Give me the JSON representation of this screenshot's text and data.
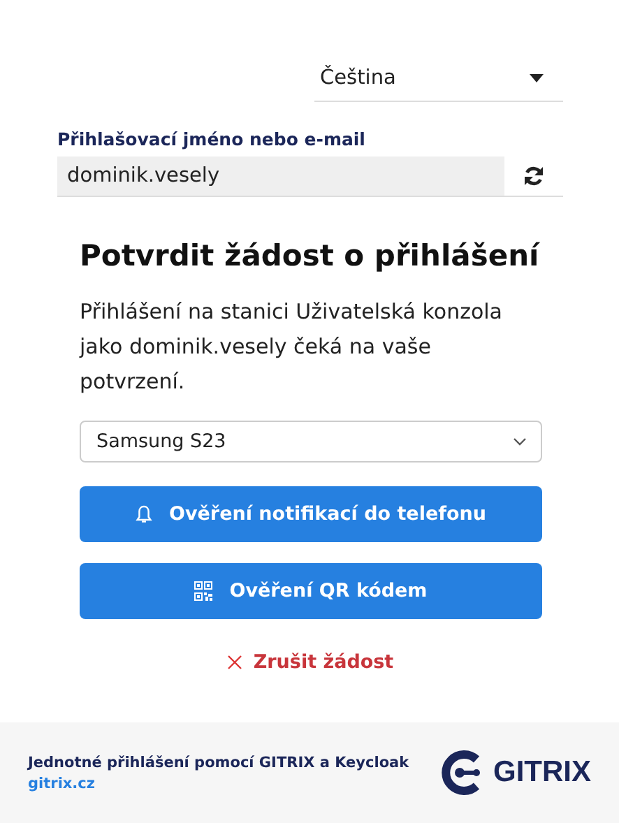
{
  "language": {
    "value": "Čeština"
  },
  "username": {
    "label": "Přihlašovací jméno nebo e-mail",
    "value": "dominik.vesely"
  },
  "heading": "Potvrdit žádost o přihlášení",
  "message": "Přihlášení na stanici Uživatelská konzola jako dominik.vesely čeká na vaše potvrzení.",
  "device_select": {
    "value": "Samsung S23"
  },
  "buttons": [
    {
      "kind": "notification",
      "label": "Ověření notifikací do telefonu"
    },
    {
      "kind": "qr",
      "label": "Ověření QR kódem"
    }
  ],
  "cancel": "Zrušit žádost",
  "footer": {
    "text": "Jednotné přihlášení pomocí GITRIX a Keycloak",
    "link": "gitrix.cz",
    "logo_text": "GITRIX"
  }
}
